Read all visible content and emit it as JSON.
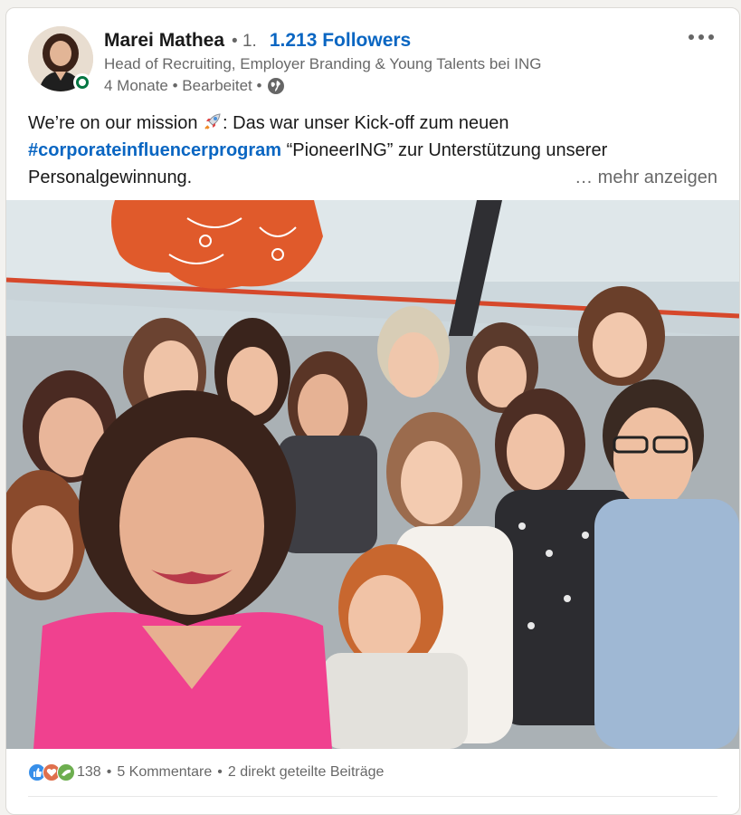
{
  "author": {
    "name": "Marei Mathea",
    "degree": "• 1.",
    "followers": "1.213 Followers",
    "headline": "Head of Recruiting, Employer Branding & Young Talents bei ING",
    "time": "4 Monate • Bearbeitet •",
    "visibility_icon": "globe-icon"
  },
  "post": {
    "text_part1": "We’re on our mission ",
    "text_part2": ": Das war unser Kick-off zum neuen",
    "hashtag": "#corporateinfluencerprogram",
    "text_part3": " “PioneerING” zur Unterstützung unserer",
    "text_part4": "Personalgewinnung.",
    "see_more": "… mehr anzeigen"
  },
  "social": {
    "reaction_icons": [
      "like-icon",
      "love-icon",
      "support-icon"
    ],
    "reaction_count": "138",
    "comments": "5 Kommentare",
    "separator": "•",
    "reposts": "2 direkt geteilte Beiträge"
  },
  "colors": {
    "link_blue": "#0a66c2",
    "online_green": "#057642",
    "ing_orange": "#e05a2b",
    "pink_dress": "#f0418f"
  }
}
